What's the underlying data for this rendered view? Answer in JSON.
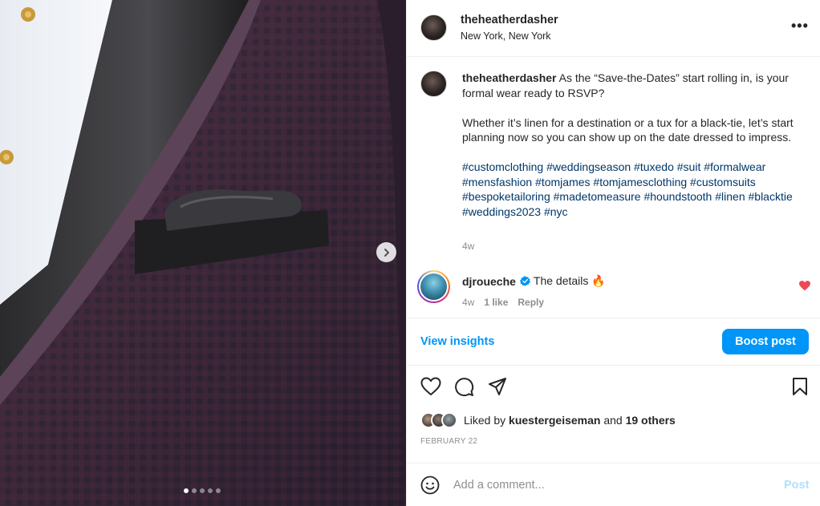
{
  "post": {
    "author": "theheatherdasher",
    "location": "New York, New York",
    "more_icon": "•••",
    "caption": {
      "username": "theheatherdasher",
      "line1": "As the “Save-the-Dates” start rolling in, is your formal wear ready to RSVP?",
      "line2": "Whether it’s linen for a destination or a tux for a black-tie, let’s start planning now so you can show up on the date dressed to impress.",
      "hashtags": [
        "#customclothing",
        "#weddingseason",
        "#tuxedo",
        "#suit",
        "#formalwear",
        "#mensfashion",
        "#tomjames",
        "#tomjamesclothing",
        "#customsuits",
        "#bespoketailoring",
        "#madetomeasure",
        "#houndstooth",
        "#linen",
        "#blacktie",
        "#weddings2023",
        "#nyc"
      ],
      "time": "4w"
    },
    "comments": [
      {
        "username": "djroueche",
        "verified": true,
        "text": "The details 🔥",
        "time": "4w",
        "likes": "1 like",
        "reply": "Reply",
        "liked": true
      }
    ],
    "insights_label": "View insights",
    "boost_label": "Boost post",
    "liked_by": {
      "prefix": "Liked by",
      "user": "kuestergeiseman",
      "joiner": "and",
      "others": "19 others"
    },
    "date": "FEBRUARY 22",
    "add_comment_placeholder": "Add a comment...",
    "post_label": "Post"
  },
  "carousel": {
    "slide_count": 5,
    "active_slide": 1
  },
  "colors": {
    "link_blue": "#0095f6",
    "hashtag": "#00376b",
    "like_red": "#ed4956",
    "muted": "#8e8e8e"
  },
  "icons": {
    "like": "heart-icon",
    "comment": "comment-icon",
    "share": "share-icon",
    "save": "bookmark-icon",
    "emoji": "emoji-icon",
    "next": "chevron-right-icon",
    "verified": "verified-badge-icon"
  }
}
